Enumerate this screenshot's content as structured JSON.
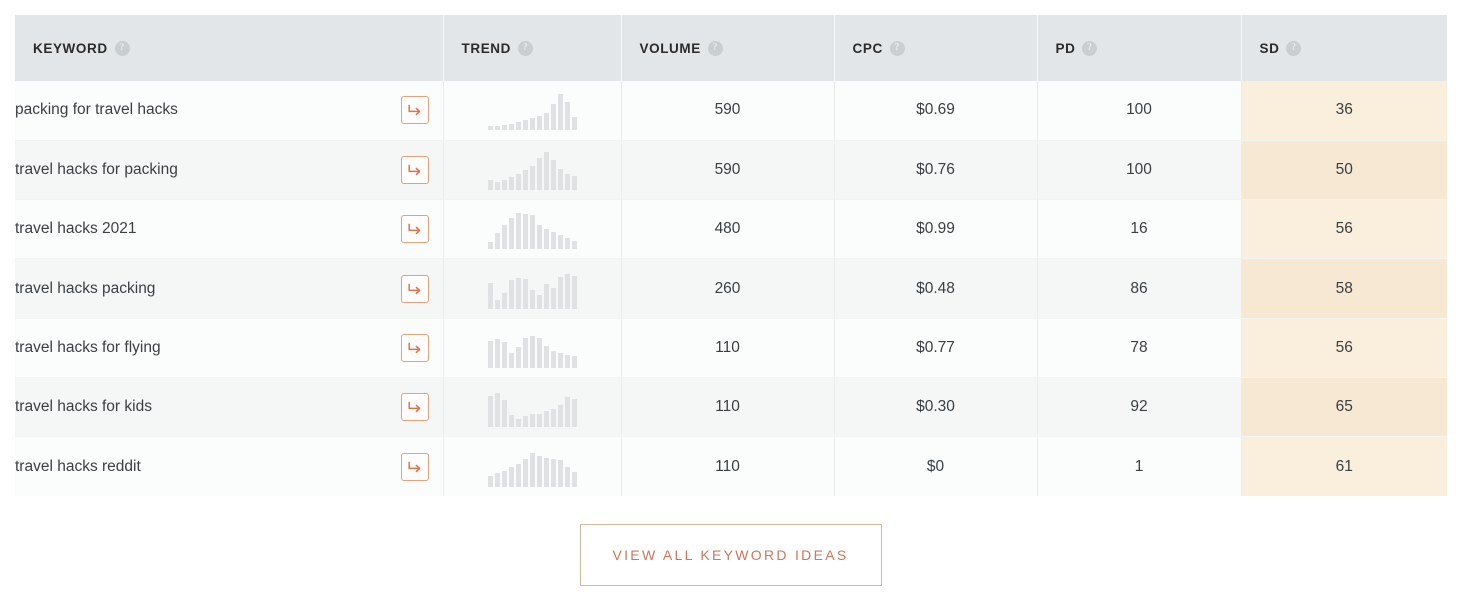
{
  "table": {
    "columns": [
      {
        "label": "KEYWORD",
        "help": "?",
        "name": "keyword"
      },
      {
        "label": "TREND",
        "help": "?",
        "name": "trend"
      },
      {
        "label": "VOLUME",
        "help": "?",
        "name": "volume"
      },
      {
        "label": "CPC",
        "help": "?",
        "name": "cpc"
      },
      {
        "label": "PD",
        "help": "?",
        "name": "pd"
      },
      {
        "label": "SD",
        "help": "?",
        "name": "sd"
      }
    ],
    "rows": [
      {
        "keyword": "packing for travel hacks",
        "action_icon": "arrow-right-curved-icon",
        "trend": [
          8,
          7,
          9,
          11,
          14,
          17,
          20,
          23,
          28,
          43,
          60,
          47,
          22
        ],
        "volume": "590",
        "cpc": "$0.69",
        "pd": "100",
        "sd": "36"
      },
      {
        "keyword": "travel hacks for packing",
        "action_icon": "arrow-right-curved-icon",
        "trend": [
          16,
          13,
          17,
          22,
          26,
          33,
          40,
          52,
          62,
          50,
          34,
          27,
          23
        ],
        "volume": "590",
        "cpc": "$0.76",
        "pd": "100",
        "sd": "50"
      },
      {
        "keyword": "travel hacks 2021",
        "action_icon": "arrow-right-curved-icon",
        "trend": [
          12,
          26,
          40,
          52,
          60,
          58,
          56,
          40,
          34,
          29,
          23,
          18,
          13
        ],
        "volume": "480",
        "cpc": "$0.99",
        "pd": "16",
        "sd": "56"
      },
      {
        "keyword": "travel hacks packing",
        "action_icon": "arrow-right-curved-icon",
        "trend": [
          42,
          14,
          26,
          47,
          50,
          48,
          30,
          22,
          40,
          34,
          52,
          57,
          54
        ],
        "volume": "260",
        "cpc": "$0.48",
        "pd": "86",
        "sd": "58"
      },
      {
        "keyword": "travel hacks for flying",
        "action_icon": "arrow-right-curved-icon",
        "trend": [
          44,
          47,
          43,
          24,
          34,
          50,
          52,
          50,
          36,
          27,
          24,
          22,
          20
        ],
        "volume": "110",
        "cpc": "$0.77",
        "pd": "78",
        "sd": "56"
      },
      {
        "keyword": "travel hacks for kids",
        "action_icon": "arrow-right-curved-icon",
        "trend": [
          52,
          56,
          44,
          20,
          14,
          19,
          22,
          22,
          27,
          30,
          36,
          50,
          47
        ],
        "volume": "110",
        "cpc": "$0.30",
        "pd": "92",
        "sd": "65"
      },
      {
        "keyword": "travel hacks reddit",
        "action_icon": "arrow-right-curved-icon",
        "trend": [
          18,
          22,
          26,
          33,
          38,
          45,
          56,
          50,
          48,
          46,
          44,
          33,
          24
        ],
        "volume": "110",
        "cpc": "$0",
        "pd": "1",
        "sd": "61"
      }
    ]
  },
  "footer": {
    "view_all_label": "VIEW ALL KEYWORD IDEAS"
  },
  "colors": {
    "accent": "#d2755a",
    "sd_highlight_odd": "#faeedd",
    "sd_highlight_even": "#f7e8d4",
    "header_background": "#e2e6e8"
  }
}
